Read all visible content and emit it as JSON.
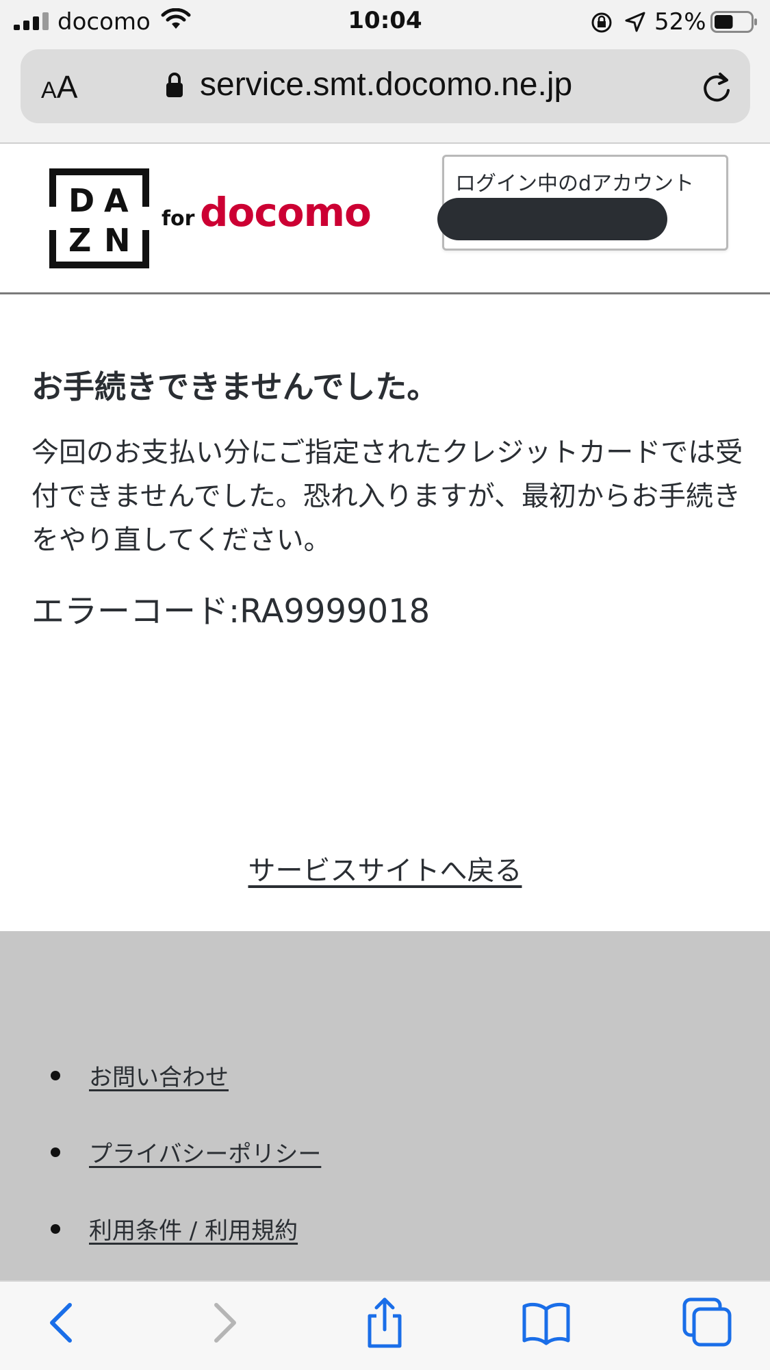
{
  "status_bar": {
    "carrier": "docomo",
    "time": "10:04",
    "battery_percent": "52%",
    "battery_level": 0.52
  },
  "address_bar": {
    "text_size_label_small": "A",
    "text_size_label_large": "A",
    "url": "service.smt.docomo.ne.jp"
  },
  "header": {
    "logo_letters": [
      "D",
      "A",
      "Z",
      "N"
    ],
    "for_label": "for",
    "brand": "docomo",
    "account_label": "ログイン中のdアカウント",
    "brand_color": "#cc0033"
  },
  "main": {
    "title": "お手続きできませんでした。",
    "message": "今回のお支払い分にご指定されたクレジットカードでは受付できませんでした。恐れ入りますが、最初からお手続きをやり直してください。",
    "error_code": "エラーコード:RA9999018",
    "back_link": "サービスサイトへ戻る"
  },
  "footer": {
    "links": [
      "お問い合わせ",
      "プライバシーポリシー",
      "利用条件 / 利用規約"
    ]
  },
  "toolbar": {
    "icons": [
      "back-icon",
      "forward-icon",
      "share-icon",
      "bookmarks-icon",
      "tabs-icon"
    ],
    "accent_color": "#1a6ee8"
  }
}
